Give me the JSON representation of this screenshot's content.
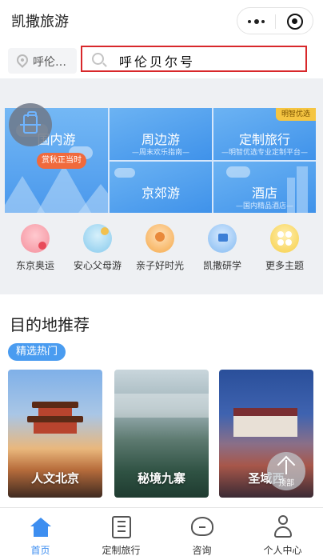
{
  "app": {
    "title": "凯撒旅游"
  },
  "search": {
    "location": "呼伦…",
    "query": "呼伦贝尔号"
  },
  "categories": {
    "domestic": {
      "label": "国内游",
      "badge": "赏秋正当时"
    },
    "nearby": {
      "label": "周边游",
      "sub": "—周末欢乐指南—"
    },
    "custom": {
      "label": "定制旅行",
      "sub": "—明智优选专业定制平台—",
      "badge": "明智优选"
    },
    "suburb": {
      "label": "京郊游"
    },
    "hotel": {
      "label": "酒店",
      "sub": "—国内精品酒店—"
    }
  },
  "themes": [
    {
      "label": "东京奥运",
      "icon": "olympics-icon"
    },
    {
      "label": "安心父母游",
      "icon": "parents-icon"
    },
    {
      "label": "亲子好时光",
      "icon": "family-icon"
    },
    {
      "label": "凯撒研学",
      "icon": "study-icon"
    },
    {
      "label": "更多主题",
      "icon": "more-themes-icon"
    }
  ],
  "destinations": {
    "title": "目的地推荐",
    "filter": "精选热门",
    "cards": [
      {
        "label": "人文北京"
      },
      {
        "label": "秘境九寨"
      },
      {
        "label": "圣域西"
      }
    ]
  },
  "back_to_top": "顶部",
  "tabbar": [
    {
      "label": "首页",
      "icon": "home-icon",
      "active": true
    },
    {
      "label": "定制旅行",
      "icon": "custom-trip-icon"
    },
    {
      "label": "咨询",
      "icon": "consult-icon"
    },
    {
      "label": "个人中心",
      "icon": "profile-icon"
    }
  ],
  "colors": {
    "accent": "#3d8ef0",
    "search_border": "#d8282b",
    "promo": "#f06a3d"
  }
}
